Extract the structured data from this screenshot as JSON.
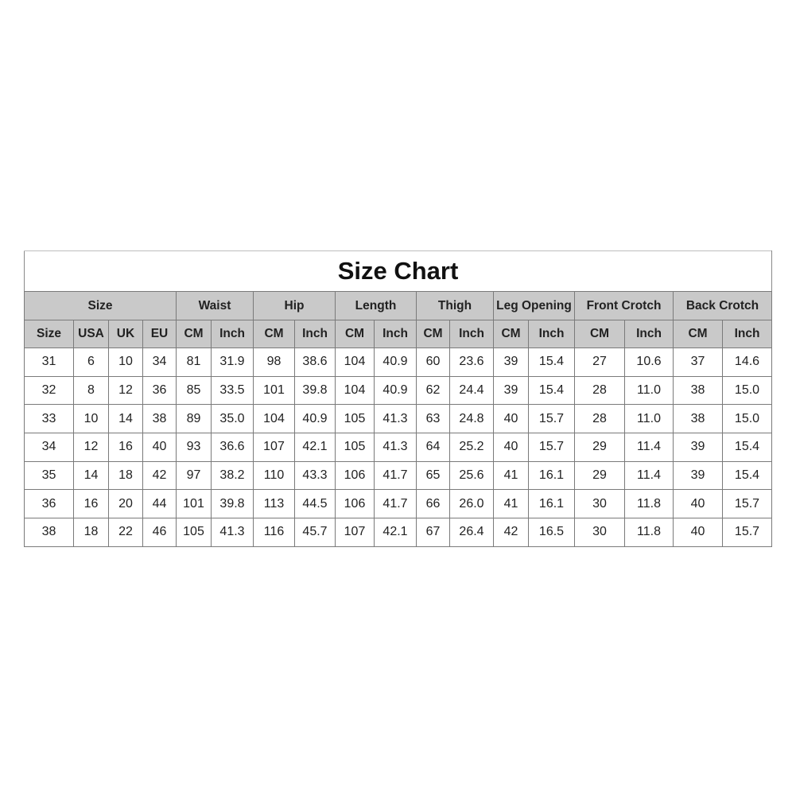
{
  "chart_data": {
    "type": "table",
    "title": "Size Chart",
    "group_headers": [
      {
        "label": "Size",
        "span": 4
      },
      {
        "label": "Waist",
        "span": 2
      },
      {
        "label": "Hip",
        "span": 2
      },
      {
        "label": "Length",
        "span": 2
      },
      {
        "label": "Thigh",
        "span": 2
      },
      {
        "label": "Leg Opening",
        "span": 2
      },
      {
        "label": "Front Crotch",
        "span": 2
      },
      {
        "label": "Back Crotch",
        "span": 2
      }
    ],
    "columns": [
      "Size",
      "USA",
      "UK",
      "EU",
      "CM",
      "Inch",
      "CM",
      "Inch",
      "CM",
      "Inch",
      "CM",
      "Inch",
      "CM",
      "Inch",
      "CM",
      "Inch",
      "CM",
      "Inch"
    ],
    "rows": [
      [
        "31",
        "6",
        "10",
        "34",
        "81",
        "31.9",
        "98",
        "38.6",
        "104",
        "40.9",
        "60",
        "23.6",
        "39",
        "15.4",
        "27",
        "10.6",
        "37",
        "14.6"
      ],
      [
        "32",
        "8",
        "12",
        "36",
        "85",
        "33.5",
        "101",
        "39.8",
        "104",
        "40.9",
        "62",
        "24.4",
        "39",
        "15.4",
        "28",
        "11.0",
        "38",
        "15.0"
      ],
      [
        "33",
        "10",
        "14",
        "38",
        "89",
        "35.0",
        "104",
        "40.9",
        "105",
        "41.3",
        "63",
        "24.8",
        "40",
        "15.7",
        "28",
        "11.0",
        "38",
        "15.0"
      ],
      [
        "34",
        "12",
        "16",
        "40",
        "93",
        "36.6",
        "107",
        "42.1",
        "105",
        "41.3",
        "64",
        "25.2",
        "40",
        "15.7",
        "29",
        "11.4",
        "39",
        "15.4"
      ],
      [
        "35",
        "14",
        "18",
        "42",
        "97",
        "38.2",
        "110",
        "43.3",
        "106",
        "41.7",
        "65",
        "25.6",
        "41",
        "16.1",
        "29",
        "11.4",
        "39",
        "15.4"
      ],
      [
        "36",
        "16",
        "20",
        "44",
        "101",
        "39.8",
        "113",
        "44.5",
        "106",
        "41.7",
        "66",
        "26.0",
        "41",
        "16.1",
        "30",
        "11.8",
        "40",
        "15.7"
      ],
      [
        "38",
        "18",
        "22",
        "46",
        "105",
        "41.3",
        "116",
        "45.7",
        "107",
        "42.1",
        "67",
        "26.4",
        "42",
        "16.5",
        "30",
        "11.8",
        "40",
        "15.7"
      ]
    ]
  },
  "colors": {
    "header_bg": "#c9c9c9",
    "border": "#7a7a7a"
  }
}
